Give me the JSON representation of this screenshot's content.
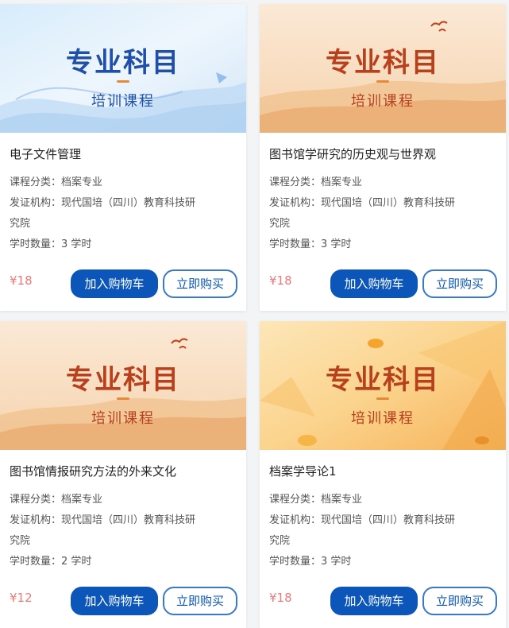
{
  "courses": [
    {
      "banner_title": "专业科目",
      "banner_subtitle": "培训课程",
      "banner_theme": "blue-waves",
      "title": "电子文件管理",
      "category_label": "课程分类：",
      "category": "档案专业",
      "issuer_label": "发证机构：",
      "issuer_line1": "现代国培（四川）教育科技研",
      "issuer_line2": "究院",
      "hours_label": "学时数量：",
      "hours": "3 学时",
      "price": "¥18",
      "cart_label": "加入购物车",
      "buy_label": "立即购买"
    },
    {
      "banner_title": "专业科目",
      "banner_subtitle": "培训课程",
      "banner_theme": "desert-dunes",
      "title": "图书馆学研究的历史观与世界观",
      "category_label": "课程分类：",
      "category": "档案专业",
      "issuer_label": "发证机构：",
      "issuer_line1": "现代国培（四川）教育科技研",
      "issuer_line2": "究院",
      "hours_label": "学时数量：",
      "hours": "3 学时",
      "price": "¥18",
      "cart_label": "加入购物车",
      "buy_label": "立即购买"
    },
    {
      "banner_title": "专业科目",
      "banner_subtitle": "培训课程",
      "banner_theme": "desert-dunes",
      "title": "图书馆情报研究方法的外来文化",
      "category_label": "课程分类：",
      "category": "档案专业",
      "issuer_label": "发证机构：",
      "issuer_line1": "现代国培（四川）教育科技研",
      "issuer_line2": "究院",
      "hours_label": "学时数量：",
      "hours": "2 学时",
      "price": "¥12",
      "cart_label": "加入购物车",
      "buy_label": "立即购买"
    },
    {
      "banner_title": "专业科目",
      "banner_subtitle": "培训课程",
      "banner_theme": "ginkgo-leaves",
      "title": "档案学导论1",
      "category_label": "课程分类：",
      "category": "档案专业",
      "issuer_label": "发证机构：",
      "issuer_line1": "现代国培（四川）教育科技研",
      "issuer_line2": "究院",
      "hours_label": "学时数量：",
      "hours": "3 学时",
      "price": "¥18",
      "cart_label": "加入购物车",
      "buy_label": "立即购买"
    }
  ],
  "colors": {
    "primary_button": "#0b56b8",
    "price_text": "#f07a7a",
    "banner_blue_text": "#1f4fa8",
    "banner_orange_text": "#b8401c"
  }
}
